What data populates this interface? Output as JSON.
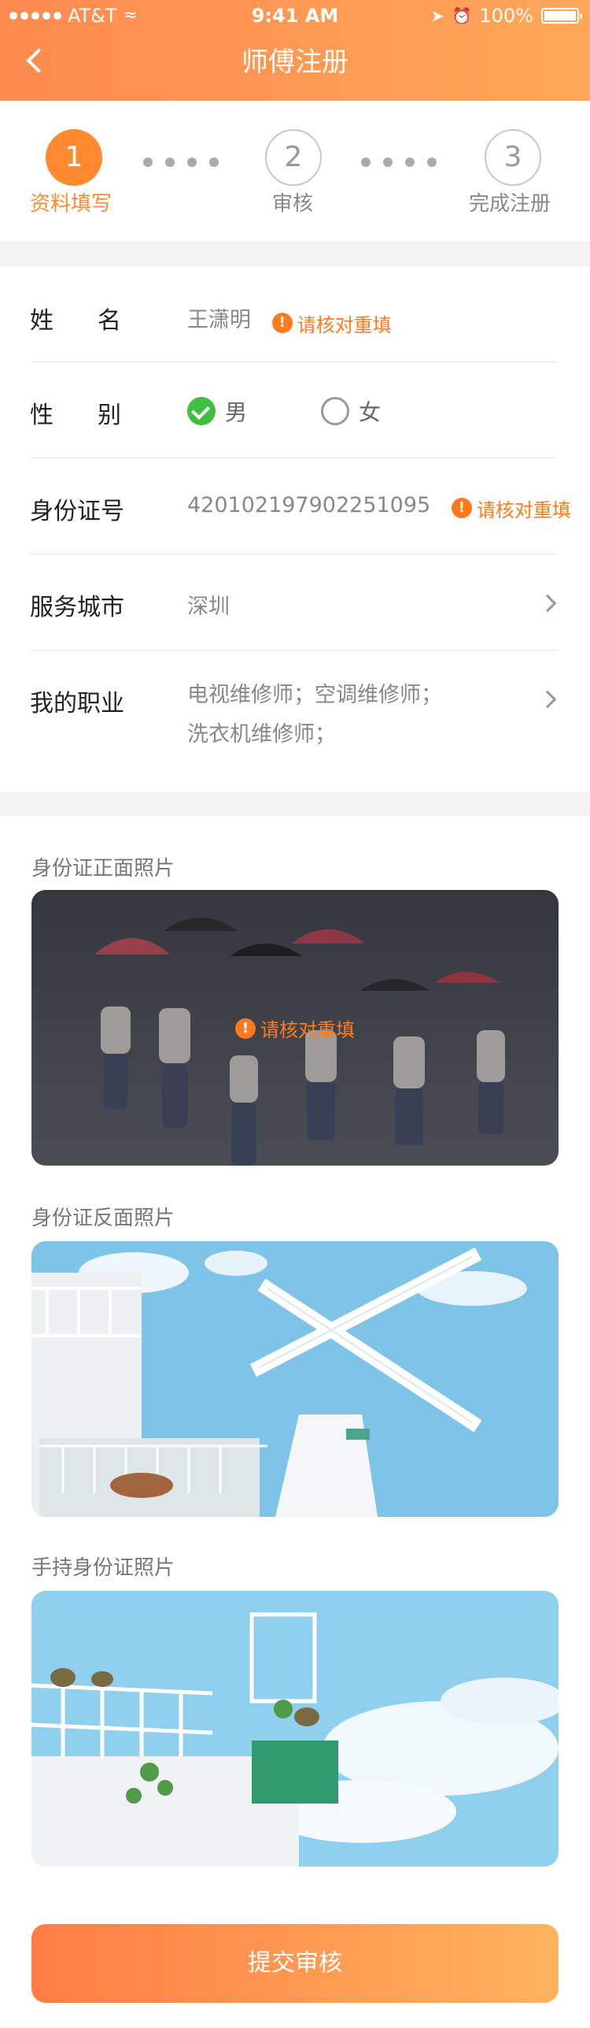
{
  "status_bar": {
    "carrier": "AT&T",
    "time": "9:41 AM",
    "battery": "100%"
  },
  "nav": {
    "title": "师傅注册"
  },
  "steps": [
    {
      "number": "1",
      "label": "资料填写",
      "state": "active"
    },
    {
      "number": "2",
      "label": "审核",
      "state": "idle"
    },
    {
      "number": "3",
      "label": "完成注册",
      "state": "idle"
    }
  ],
  "form": {
    "name": {
      "label": "姓名",
      "value": "王潇明",
      "warning": "请核对重填"
    },
    "gender": {
      "label": "性别",
      "options": [
        "男",
        "女"
      ],
      "selected": "男"
    },
    "id_number": {
      "label": "身份证号",
      "value": "420102197902251095",
      "warning": "请核对重填"
    },
    "city": {
      "label": "服务城市",
      "value": "深圳"
    },
    "job": {
      "label": "我的职业",
      "lines": [
        "电视维修师；空调维修师；",
        "洗衣机维修师；"
      ]
    }
  },
  "photos": {
    "front": {
      "title": "身份证正面照片",
      "warning": "请核对重填"
    },
    "back": {
      "title": "身份证反面照片"
    },
    "handheld": {
      "title": "手持身份证照片"
    }
  },
  "submit_label": "提交审核",
  "colors": {
    "brand": "#ff8a2f",
    "warning": "#ff7a1c",
    "success": "#3fbf3f"
  }
}
